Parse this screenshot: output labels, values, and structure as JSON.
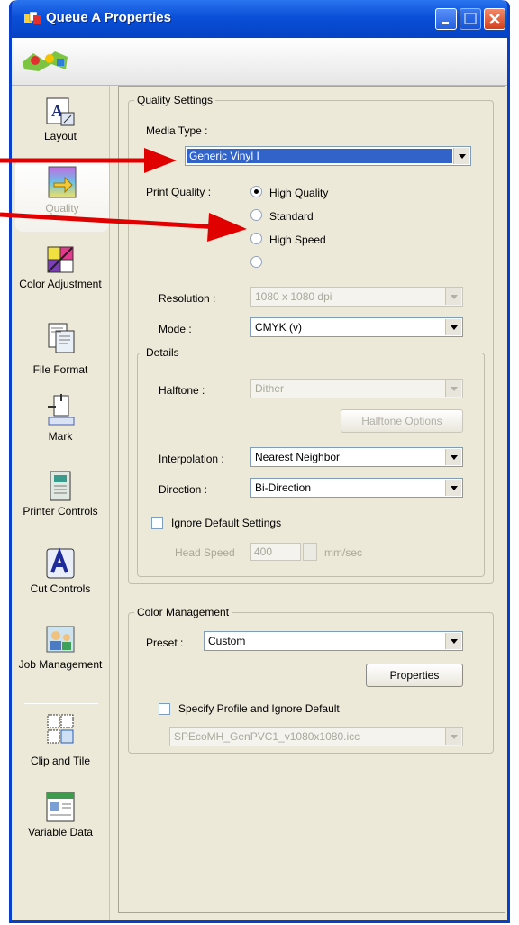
{
  "window": {
    "title": "Queue A Properties"
  },
  "sidebar": {
    "items": [
      {
        "label": "Layout",
        "icon": "layout-icon"
      },
      {
        "label": "Quality",
        "icon": "quality-icon",
        "selected": true
      },
      {
        "label": "Color Adjustment",
        "icon": "color-adjustment-icon"
      },
      {
        "label": "File Format",
        "icon": "file-format-icon"
      },
      {
        "label": "Mark",
        "icon": "mark-icon"
      },
      {
        "label": "Printer Controls",
        "icon": "printer-controls-icon"
      },
      {
        "label": "Cut Controls",
        "icon": "cut-controls-icon"
      },
      {
        "label": "Job Management",
        "icon": "job-management-icon"
      },
      {
        "label": "Clip and Tile",
        "icon": "clip-tile-icon"
      },
      {
        "label": "Variable Data",
        "icon": "variable-data-icon"
      }
    ]
  },
  "quality": {
    "legend": "Quality Settings",
    "media_type_label": "Media Type :",
    "media_type_value": "Generic Vinyl I",
    "print_quality_label": "Print Quality :",
    "options": [
      "High Quality",
      "Standard",
      "High Speed",
      ""
    ],
    "selected_option": "High Quality",
    "resolution_label": "Resolution :",
    "resolution_value": "1080 x 1080 dpi",
    "mode_label": "Mode :",
    "mode_value": "CMYK (v)"
  },
  "details": {
    "legend": "Details",
    "halftone_label": "Halftone :",
    "halftone_value": "Dither",
    "halftone_options_button": "Halftone Options",
    "interpolation_label": "Interpolation :",
    "interpolation_value": "Nearest Neighbor",
    "direction_label": "Direction :",
    "direction_value": "Bi-Direction",
    "ignore_default_label": "Ignore Default Settings",
    "head_speed_label": "Head Speed",
    "head_speed_value": "400",
    "head_speed_unit": "mm/sec"
  },
  "color_management": {
    "legend": "Color Management",
    "preset_label": "Preset :",
    "preset_value": "Custom",
    "properties_button": "Properties",
    "specify_profile_label": "Specify Profile and Ignore Default",
    "profile_value": "SPEcoMH_GenPVC1_v1080x1080.icc"
  },
  "colors": {
    "title_bar": "#0a4fd8",
    "selected_media": "#3263c8",
    "annotation_arrow": "#e00000"
  }
}
